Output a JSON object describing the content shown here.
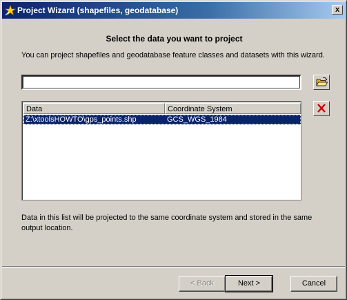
{
  "window": {
    "title": "Project Wizard (shapefiles, geodatabase)",
    "close_label": "x"
  },
  "content": {
    "heading": "Select the data you want to project",
    "description": "You can project shapefiles and geodatabase feature classes and datasets with this wizard.",
    "path_value": "",
    "note": "Data in this list will be projected to the same coordinate system and stored in the same output location."
  },
  "table": {
    "columns": [
      "Data",
      "Coordinate System"
    ],
    "rows": [
      {
        "data": "Z:\\xtoolsHOWTO\\gps_points.shp",
        "coordinate_system": "GCS_WGS_1984",
        "selected": true
      }
    ]
  },
  "buttons": {
    "back_label": "< Back",
    "next_label": "Next >",
    "cancel_label": "Cancel"
  },
  "icons": {
    "title": "wizard-star-icon",
    "browse": "open-folder-icon",
    "remove": "red-x-icon"
  },
  "colors": {
    "selection": "#0a246a",
    "remove_x": "#cc0000",
    "folder": "#e8b800"
  }
}
